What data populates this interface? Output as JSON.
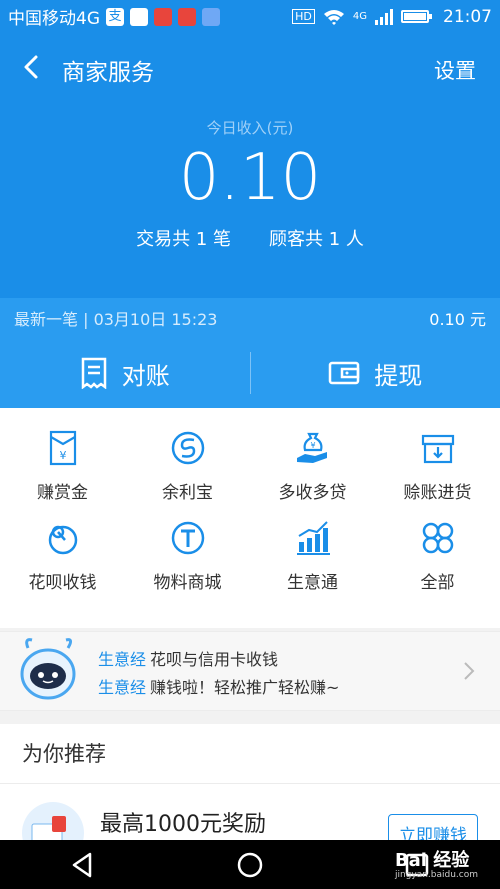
{
  "status_bar": {
    "carrier": "中国移动4G",
    "network": "4G",
    "time": "21:07"
  },
  "header": {
    "title": "商家服务",
    "settings_label": "设置",
    "income_label": "今日收入(元)",
    "income_value": "0.10",
    "transactions": "交易共 1 笔",
    "customers": "顾客共 1 人"
  },
  "latest": {
    "text": "最新一笔 | 03月10日 15:23",
    "amount": "0.10 元"
  },
  "actions": [
    {
      "label": "对账",
      "icon": "receipt-icon"
    },
    {
      "label": "提现",
      "icon": "wallet-icon"
    }
  ],
  "grid": [
    {
      "label": "赚赏金",
      "icon": "envelope-yen-icon"
    },
    {
      "label": "余利宝",
      "icon": "yulibao-icon"
    },
    {
      "label": "多收多贷",
      "icon": "money-bag-hand-icon"
    },
    {
      "label": "赊账进货",
      "icon": "box-icon"
    },
    {
      "label": "花呗收钱",
      "icon": "huabei-icon"
    },
    {
      "label": "物料商城",
      "icon": "t-badge-icon"
    },
    {
      "label": "生意通",
      "icon": "bar-chart-icon"
    },
    {
      "label": "全部",
      "icon": "four-petals-icon"
    }
  ],
  "banner": {
    "line1_highlight": "生意经",
    "line1_text": "花呗与信用卡收钱",
    "line2_highlight": "生意经",
    "line2_text": "赚钱啦！轻松推广轻松赚~"
  },
  "recommend": {
    "section_title": "为你推荐",
    "item_title": "最高1000元奖励",
    "item_button": "立即赚钱"
  },
  "watermark": {
    "brand": "Bai 经验",
    "url": "jingyan.baidu.com"
  },
  "colors": {
    "primary": "#1a8ee8",
    "action_bg": "#2a9cf0"
  }
}
